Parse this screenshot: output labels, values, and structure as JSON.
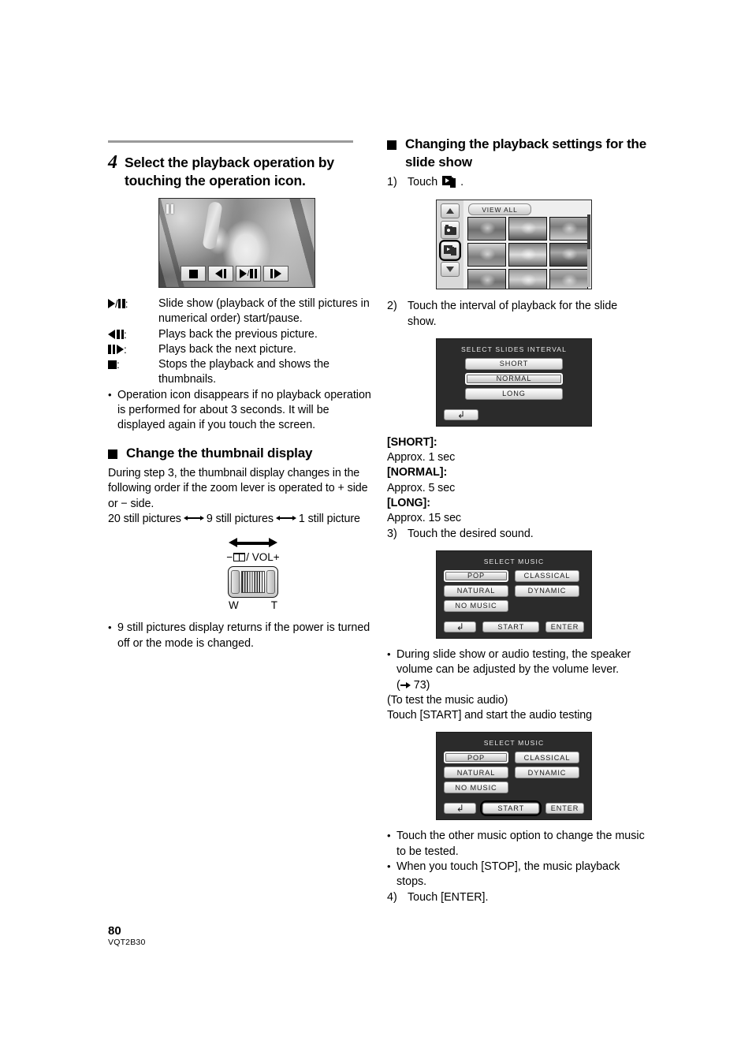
{
  "page": {
    "number": "80",
    "code": "VQT2B30"
  },
  "left": {
    "step4": {
      "number": "4",
      "title": "Select the playback operation by touching the operation icon."
    },
    "photo": {
      "pause_indicator": "pause-indicator",
      "op_buttons": [
        {
          "name": "stop-button",
          "glyph": "stop"
        },
        {
          "name": "previous-button",
          "glyph": "prev"
        },
        {
          "name": "play-pause-button",
          "glyph": "play-pause"
        },
        {
          "name": "next-button",
          "glyph": "next"
        }
      ]
    },
    "legend": [
      {
        "icon": "play-pause",
        "text": "Slide show (playback of the still pictures in numerical order) start/pause."
      },
      {
        "icon": "previous",
        "text": "Plays back the previous picture."
      },
      {
        "icon": "next",
        "text": "Plays back the next picture."
      },
      {
        "icon": "stop",
        "text": "Stops the playback and shows the thumbnails."
      }
    ],
    "note1": "Operation icon disappears if no playback operation is performed for about 3 seconds. It will be displayed again if you touch the screen.",
    "thumbnail_section": {
      "title": "Change the thumbnail display",
      "para1_a": "During step 3, the thumbnail display changes in the following order if the zoom lever is operated to ",
      "para1_plus": "+",
      "para1_b": " side or ",
      "para1_minus": "−",
      "para1_c": " side.",
      "order_1": "20 still pictures",
      "order_2": "9 still pictures",
      "order_3": "1 still picture"
    },
    "lever": {
      "minus": "−",
      "label_mid": "/ VOL",
      "plus": "+",
      "w": "W",
      "t": "T"
    },
    "note2": "9 still pictures display returns if the power is turned off or the mode is changed."
  },
  "right": {
    "section_title": "Changing the playback settings for the slide show",
    "step1": {
      "num": "1)",
      "text_before": "Touch",
      "text_after": "."
    },
    "viewall_screen": {
      "view_all_label": "VIEW ALL",
      "side_buttons": [
        "scroll-up",
        "photo-mode",
        "slideshow-mode",
        "scroll-down"
      ],
      "selected_side_button": "slideshow-mode",
      "thumbnail_count": 9
    },
    "step2": {
      "num": "2)",
      "text": "Touch the interval of playback for the slide show."
    },
    "interval_screen": {
      "title": "SELECT SLIDES INTERVAL",
      "options": [
        "SHORT",
        "NORMAL",
        "LONG"
      ],
      "selected": "NORMAL",
      "back_button": "back"
    },
    "interval_defs": [
      {
        "label": "[SHORT]:",
        "value": "Approx. 1 sec"
      },
      {
        "label": "[NORMAL]:",
        "value": "Approx. 5 sec"
      },
      {
        "label": "[LONG]:",
        "value": "Approx. 15 sec"
      }
    ],
    "step3": {
      "num": "3)",
      "text": "Touch the desired sound."
    },
    "music_screen_1": {
      "title": "SELECT MUSIC",
      "options": [
        "POP",
        "CLASSICAL",
        "NATURAL",
        "DYNAMIC",
        "NO MUSIC"
      ],
      "selected": "POP",
      "back_button": "back",
      "start_button": "START",
      "enter_button": "ENTER",
      "highlighted": ""
    },
    "note_volume": "During slide show or audio testing, the speaker volume can be adjusted by the volume lever.",
    "note_volume_ref": "73",
    "test_title": "(To test the music audio)",
    "test_text": "Touch [START] and start the audio testing",
    "music_screen_2": {
      "title": "SELECT MUSIC",
      "options": [
        "POP",
        "CLASSICAL",
        "NATURAL",
        "DYNAMIC",
        "NO MUSIC"
      ],
      "selected": "POP",
      "back_button": "back",
      "start_button": "START",
      "enter_button": "ENTER",
      "highlighted": "START"
    },
    "note_change_music": "Touch the other music option to change the music to be tested.",
    "note_stop": "When you touch [STOP], the music playback stops.",
    "step4": {
      "num": "4)",
      "text": "Touch [ENTER]."
    }
  }
}
